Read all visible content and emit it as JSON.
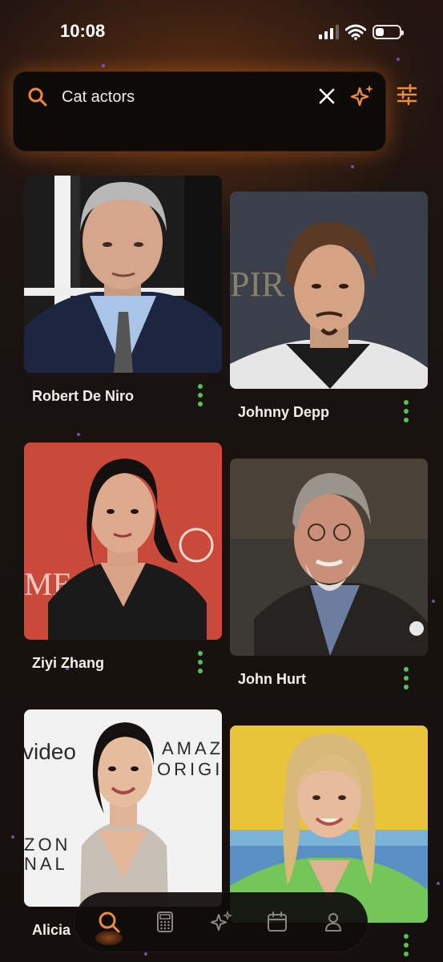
{
  "status_bar": {
    "time": "10:08"
  },
  "search": {
    "query": "Cat actors"
  },
  "icons": {
    "search": "search-icon",
    "clear": "close-icon",
    "ai": "sparkles-icon",
    "filter": "sliders-icon",
    "more": "more-vertical-icon",
    "nav_search": "search-icon",
    "nav_calculator": "calculator-icon",
    "nav_ai": "sparkles-icon",
    "nav_calendar": "calendar-icon",
    "nav_profile": "user-icon"
  },
  "colors": {
    "accent": "#ee8a3c",
    "more_dots": "#58c05a",
    "background": "#1a1210"
  },
  "results": [
    {
      "name": "Robert De Niro"
    },
    {
      "name": "Johnny Depp"
    },
    {
      "name": "Ziyi Zhang"
    },
    {
      "name": "John Hurt"
    },
    {
      "name": "Alicia"
    },
    {
      "name": ""
    }
  ],
  "nav": {
    "active": "search"
  }
}
